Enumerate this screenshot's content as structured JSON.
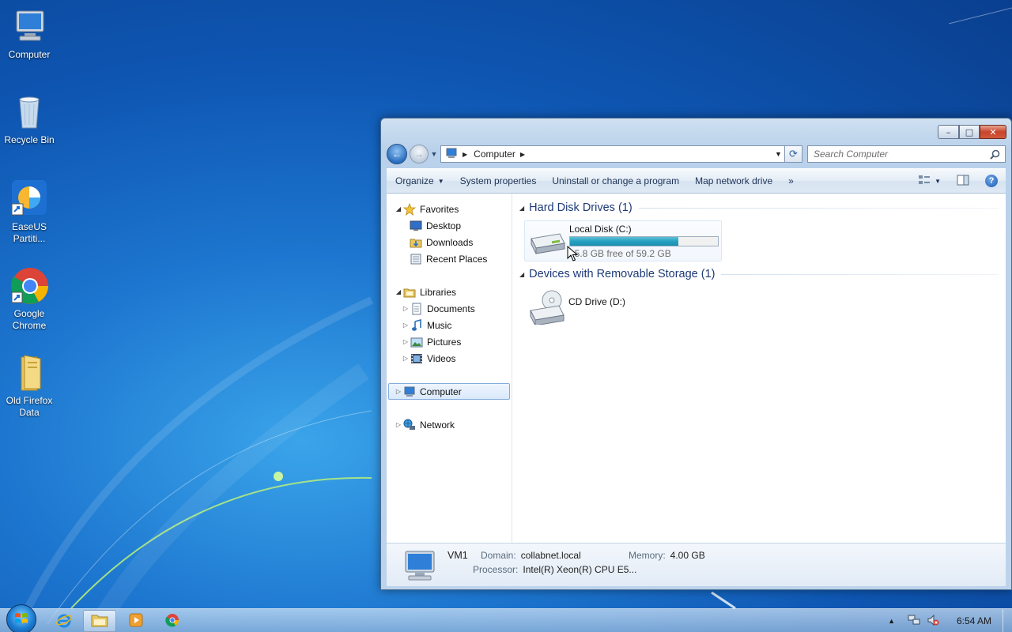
{
  "desktop": {
    "icons": [
      {
        "label": "Computer"
      },
      {
        "label": "Recycle Bin"
      },
      {
        "label": "EaseUS Partiti..."
      },
      {
        "label": "Google Chrome"
      },
      {
        "label": "Old Firefox Data"
      }
    ]
  },
  "window": {
    "controls": {
      "minimize": "–",
      "maximize": "□",
      "close": "✕"
    },
    "address": {
      "crumb": "Computer"
    },
    "search": {
      "placeholder": "Search Computer"
    },
    "toolbar": {
      "organize": "Organize",
      "system_properties": "System properties",
      "uninstall": "Uninstall or change a program",
      "map_drive": "Map network drive",
      "more": "»"
    },
    "nav": {
      "favorites": "Favorites",
      "desktop": "Desktop",
      "downloads": "Downloads",
      "recent": "Recent Places",
      "libraries": "Libraries",
      "documents": "Documents",
      "music": "Music",
      "pictures": "Pictures",
      "videos": "Videos",
      "computer": "Computer",
      "network": "Network"
    },
    "content": {
      "hdd_group": "Hard Disk Drives (1)",
      "local_disk": {
        "name": "Local Disk (C:)",
        "free": "15.8 GB free of 59.2 GB",
        "used_fraction": 0.733
      },
      "removable_group": "Devices with Removable Storage (1)",
      "cd_drive": {
        "name": "CD Drive (D:)"
      }
    },
    "details": {
      "name": "VM1",
      "domain_label": "Domain:",
      "domain_value": "collabnet.local",
      "memory_label": "Memory:",
      "memory_value": "4.00 GB",
      "processor_label": "Processor:",
      "processor_value": "Intel(R) Xeon(R) CPU E5..."
    }
  },
  "taskbar": {
    "clock": "6:54 AM"
  }
}
